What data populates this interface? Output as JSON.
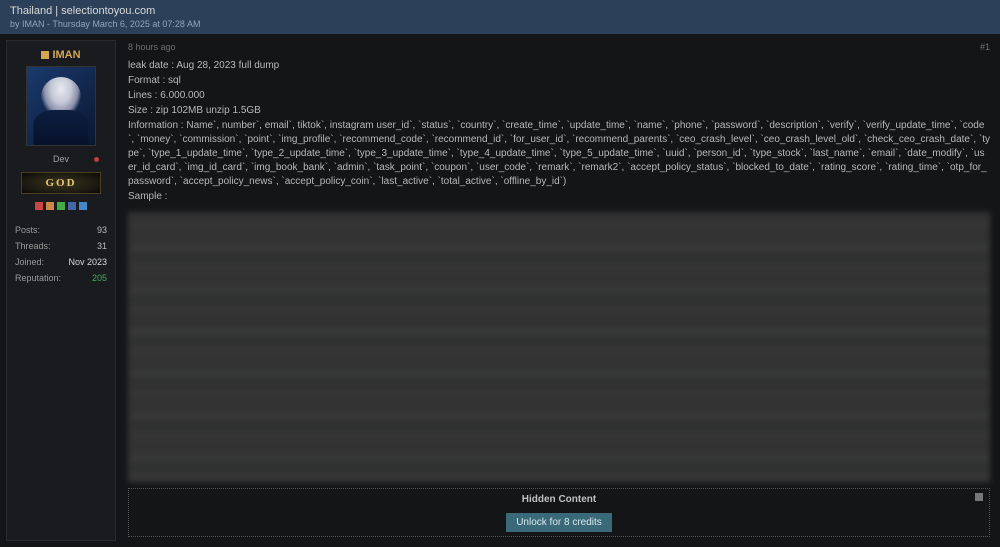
{
  "header": {
    "title": "Thailand | selectiontoyou.com",
    "byline_prefix": "by ",
    "byline_author": "IMAN",
    "byline_sep": " - ",
    "byline_date": "Thursday March 6, 2025 at 07:28 AM"
  },
  "sidebar": {
    "username": "IMAN",
    "role": "Dev",
    "rank": "GOD",
    "stats": {
      "posts_label": "Posts:",
      "posts_value": "93",
      "threads_label": "Threads:",
      "threads_value": "31",
      "joined_label": "Joined:",
      "joined_value": "Nov 2023",
      "reputation_label": "Reputation:",
      "reputation_value": "205"
    }
  },
  "post": {
    "time_ago": "8 hours ago",
    "post_number": "#1",
    "lines": {
      "leak_date": "leak date : Aug 28, 2023 full dump",
      "format": "Format : sql",
      "lines_count": "Lines : 6.000.000",
      "size": "Size : zip 102MB unzip 1.5GB",
      "info": "Information : Name`, number`, email`, tiktok`, instagram user_id`, `status`, `country`, `create_time`, `update_time`, `name`, `phone`, `password`, `description`, `verify`, `verify_update_time`, `code`, `money`, `commission`, `point`, `img_profile`, `recommend_code`, `recommend_id`, `for_user_id`, `recommend_parents`, `ceo_crash_level`, `ceo_crash_level_old`, `check_ceo_crash_date`, `type`, `type_1_update_time`, `type_2_update_time`, `type_3_update_time`, `type_4_update_time`, `type_5_update_time`, `uuid`, `person_id`, `type_stock`, `last_name`, `email`, `date_modify`, `user_id_card`, `img_id_card`, `img_book_bank`, `admin`, `task_point`, `coupon`, `user_code`, `remark`, `remark2`, `accept_policy_status`, `blocked_to_date`, `rating_score`, `rating_time`, `otp_for_password`, `accept_policy_news`, `accept_policy_coin`, `last_active`, `total_active`, `offline_by_id`)",
      "sample": "Sample :"
    }
  },
  "hidden": {
    "title": "Hidden Content",
    "unlock_label": "Unlock for 8 credits"
  }
}
